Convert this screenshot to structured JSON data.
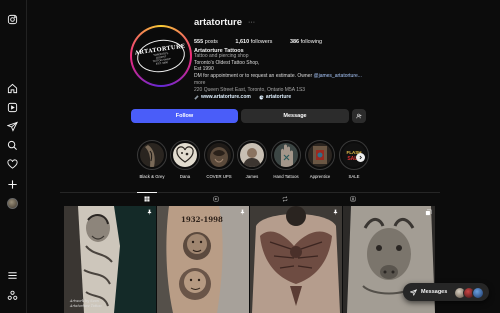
{
  "profile": {
    "username": "artatorture",
    "more_label": "···",
    "posts_count": "555",
    "posts_label": "posts",
    "followers_count": "1,610",
    "followers_label": "followers",
    "following_count": "386",
    "following_label": "following",
    "full_name": "Artatorture Tattoos",
    "category": "Tattoo and piercing shop",
    "bio_line1": "Toronto's Oldest Tattoo Shop,",
    "bio_line2": "Est 1990",
    "bio_line3": "DM for appointment or to request an estimate. Owner",
    "bio_mention": "@james_artatorture...",
    "more_link": "more",
    "address": "220 Queen Street East, Toronto, Ontario M5A 1S3",
    "website": "www.artatorture.com",
    "threads_handle": "artatorture"
  },
  "avatar_logo": {
    "main": "ARTATORTURE",
    "sub1": "TORONTO'S",
    "sub2": "OLDEST",
    "sub3": "TATTOO SHOP",
    "sub4": "EST. 1990"
  },
  "actions": {
    "follow_label": "Follow",
    "message_label": "Message"
  },
  "highlights": [
    {
      "label": "Black & Grey",
      "tone": "#6b5a4a"
    },
    {
      "label": "Dana",
      "tone": "#d9d2c5"
    },
    {
      "label": "COVER UPS",
      "tone": "#3b3530"
    },
    {
      "label": "James",
      "tone": "#8a7b6c"
    },
    {
      "label": "Hand Tattoos",
      "tone": "#7d8b86"
    },
    {
      "label": "Apprentice",
      "tone": "#5a4a3c"
    },
    {
      "label": "SALE",
      "tone": "#1c1c1c"
    }
  ],
  "sale_badge": {
    "line1": "FLASH",
    "line2": "SALE"
  },
  "posts": [
    {
      "tone_a": "#d8d2c8",
      "tone_b": "#4a4540",
      "caption1": "Artwork by Sean",
      "caption2": "Artatorture Tattoo"
    },
    {
      "tone_a": "#9a8a7c",
      "tone_b": "#5a4a3e",
      "year_text": "1932-1998"
    },
    {
      "tone_a": "#9b8579",
      "tone_b": "#6e5a50"
    },
    {
      "tone_a": "#a9a49b",
      "tone_b": "#5f5a53"
    }
  ],
  "messages": {
    "label": "Messages"
  }
}
